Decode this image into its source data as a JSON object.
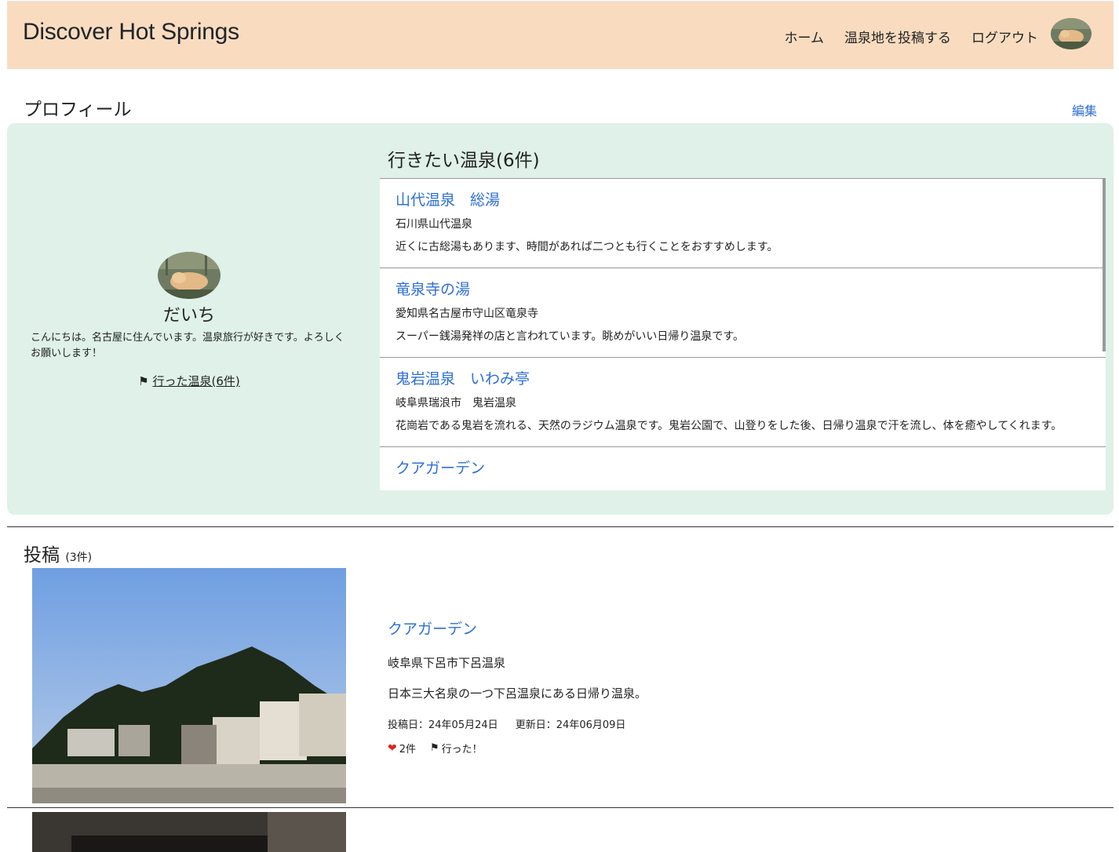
{
  "navbar": {
    "brand": "Discover Hot Springs",
    "links": [
      "ホーム",
      "温泉地を投稿する",
      "ログアウト"
    ]
  },
  "profile": {
    "heading": "プロフィール",
    "edit_label": "編集",
    "user_name": "だいち",
    "bio": "こんにちは。名古屋に住んでいます。温泉旅行が好きです。よろしくお願いします！",
    "visited_label": "行った温泉(6件)",
    "want_heading": "行きたい温泉(6件)",
    "want_list": [
      {
        "title": "山代温泉　総湯",
        "location": "石川県山代温泉",
        "description": "近くに古総湯もあります、時間があれば二つとも行くことをおすすめします。"
      },
      {
        "title": "竜泉寺の湯",
        "location": "愛知県名古屋市守山区竜泉寺",
        "description": "スーパー銭湯発祥の店と言われています。眺めがいい日帰り温泉です。"
      },
      {
        "title": "鬼岩温泉　いわみ亭",
        "location": "岐阜県瑞浪市　鬼岩温泉",
        "description": "花崗岩である鬼岩を流れる、天然のラジウム温泉です。鬼岩公園で、山登りをした後、日帰り温泉で汗を流し、体を癒やしてくれます。"
      },
      {
        "title": "クアガーデン",
        "location": "",
        "description": ""
      }
    ]
  },
  "posts": {
    "heading": "投稿",
    "count": "(3件)",
    "items": [
      {
        "title": "クアガーデン",
        "location": "岐阜県下呂市下呂温泉",
        "description": "日本三大名泉の一つ下呂温泉にある日帰り温泉。",
        "posted": "投稿日：24年05月24日",
        "updated": "更新日：24年06月09日",
        "likes": "2件",
        "visited": "行った！"
      }
    ]
  },
  "colors": {
    "navbar_bg": "#f9dcc0",
    "card_bg": "#dff1e8",
    "link": "#2f6fd6",
    "heart": "#e02424"
  }
}
